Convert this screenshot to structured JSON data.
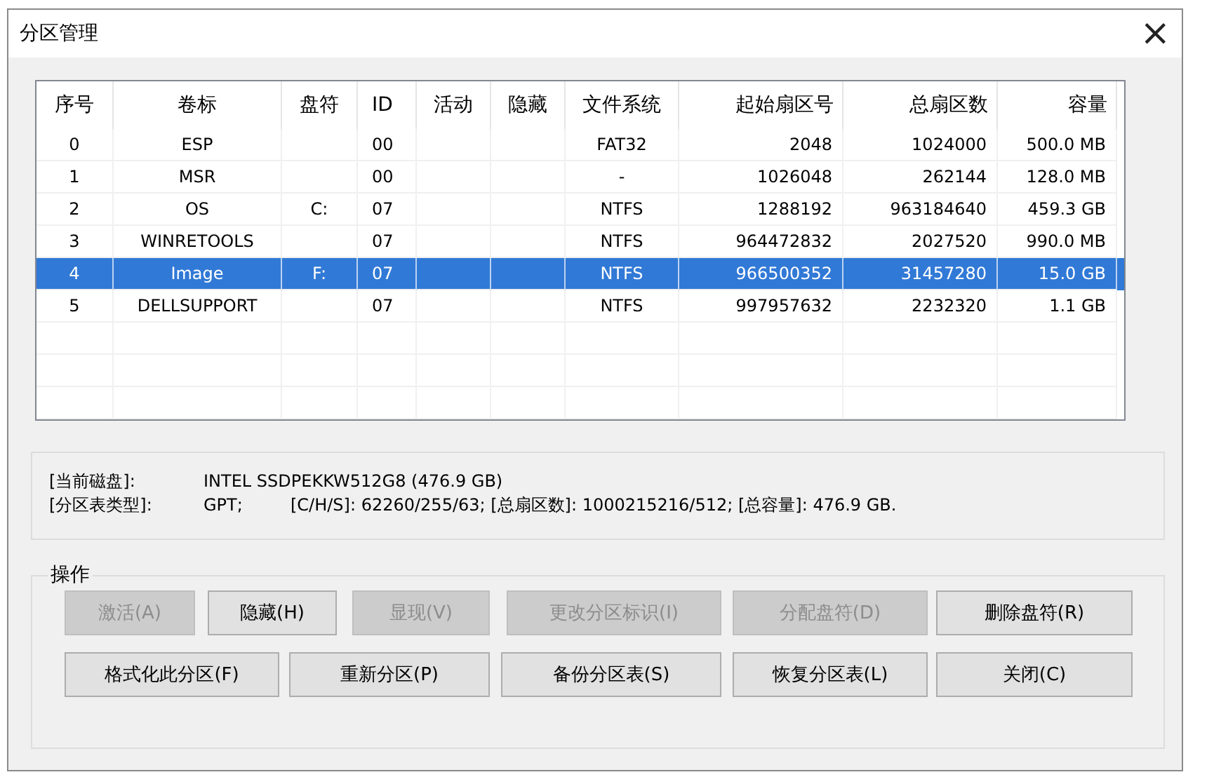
{
  "window": {
    "title": "分区管理",
    "close": "×"
  },
  "table": {
    "columns": [
      "序号",
      "卷标",
      "盘符",
      "ID",
      "活动",
      "隐藏",
      "文件系统",
      "起始扇区号",
      "总扇区数",
      "容量"
    ],
    "rows": [
      {
        "selected": false,
        "cells": [
          "0",
          "ESP",
          "",
          "00",
          "",
          "",
          "FAT32",
          "2048",
          "1024000",
          "500.0 MB"
        ]
      },
      {
        "selected": false,
        "cells": [
          "1",
          "MSR",
          "",
          "00",
          "",
          "",
          "-",
          "1026048",
          "262144",
          "128.0 MB"
        ]
      },
      {
        "selected": false,
        "cells": [
          "2",
          "OS",
          "C:",
          "07",
          "",
          "",
          "NTFS",
          "1288192",
          "963184640",
          "459.3 GB"
        ]
      },
      {
        "selected": false,
        "cells": [
          "3",
          "WINRETOOLS",
          "",
          "07",
          "",
          "",
          "NTFS",
          "964472832",
          "2027520",
          "990.0 MB"
        ]
      },
      {
        "selected": true,
        "cells": [
          "4",
          "Image",
          "F:",
          "07",
          "",
          "",
          "NTFS",
          "966500352",
          "31457280",
          "15.0 GB"
        ]
      },
      {
        "selected": false,
        "cells": [
          "5",
          "DELLSUPPORT",
          "",
          "07",
          "",
          "",
          "NTFS",
          "997957632",
          "2232320",
          "1.1 GB"
        ]
      }
    ]
  },
  "disk_info": {
    "disk_label": "[当前磁盘]:",
    "disk_value": "INTEL SSDPEKKW512G8 (476.9 GB)",
    "type_label": "[分区表类型]:",
    "type_value": "GPT;",
    "geometry": "[C/H/S]: 62260/255/63; [总扇区数]: 1000215216/512; [总容量]: 476.9 GB."
  },
  "actions": {
    "title": "操作",
    "buttons": [
      {
        "label": "激活(A)",
        "disabled": true
      },
      {
        "label": "隐藏(H)",
        "disabled": false
      },
      {
        "label": "显现(V)",
        "disabled": true
      },
      {
        "label": "更改分区标识(I)",
        "disabled": true
      },
      {
        "label": "分配盘符(D)",
        "disabled": true
      },
      {
        "label": "删除盘符(R)",
        "disabled": false
      },
      {
        "label": "格式化此分区(F)",
        "disabled": false
      },
      {
        "label": "重新分区(P)",
        "disabled": false
      },
      {
        "label": "备份分区表(S)",
        "disabled": false
      },
      {
        "label": "恢复分区表(L)",
        "disabled": false
      },
      {
        "label": "关闭(C)",
        "disabled": false
      }
    ]
  }
}
